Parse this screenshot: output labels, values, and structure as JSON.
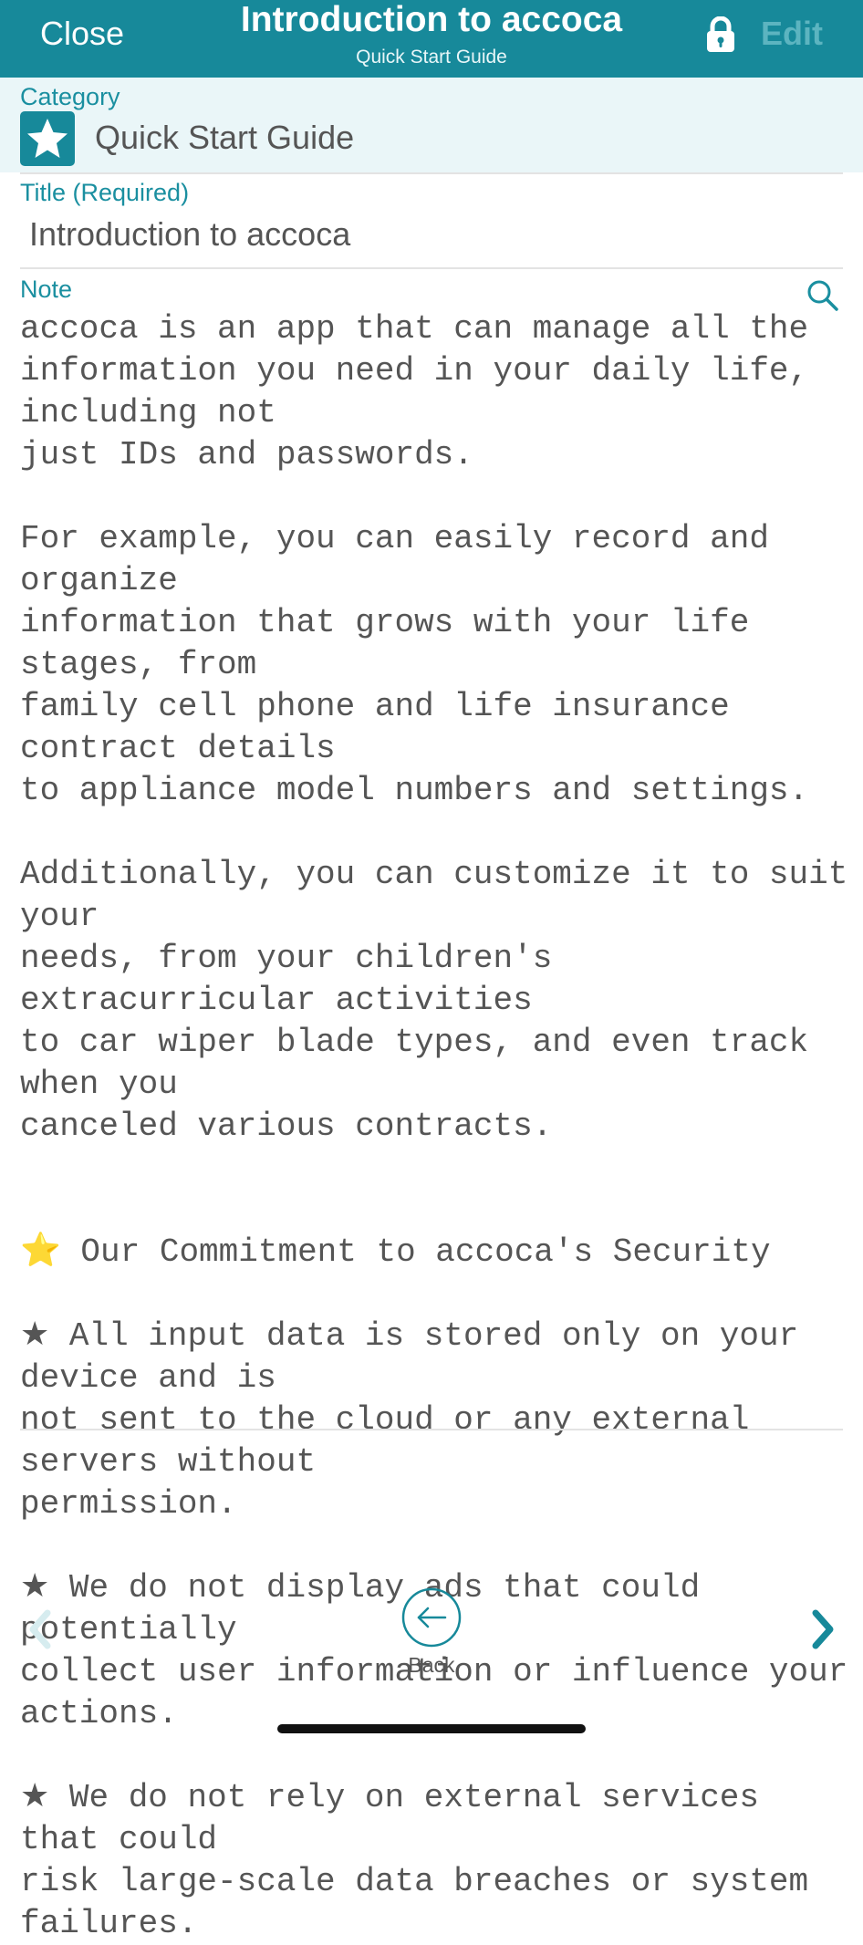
{
  "header": {
    "close_label": "Close",
    "title": "Introduction to accoca",
    "subtitle": "Quick Start Guide",
    "lock_icon": "lock-icon",
    "edit_label": "Edit"
  },
  "category": {
    "label": "Category",
    "icon": "star-icon",
    "value": "Quick Start Guide"
  },
  "title_field": {
    "label": "Title (Required)",
    "value": "Introduction to accoca"
  },
  "note": {
    "label": "Note",
    "search_icon": "search-icon",
    "text": "accoca is an app that can manage all the\ninformation you need in your daily life, including not\njust IDs and passwords.\n\nFor example, you can easily record and organize\ninformation that grows with your life stages, from\nfamily cell phone and life insurance contract details\nto appliance model numbers and settings.\n\nAdditionally, you can customize it to suit your\nneeds, from your children's extracurricular activities\nto car wiper blade types, and even track when you\ncanceled various contracts.\n\n\n⭐ Our Commitment to accoca's Security\n\n★ All input data is stored only on your device and is\nnot sent to the cloud or any external servers without\npermission.\n\n★ We do not display ads that could potentially\ncollect user information or influence your actions.\n\n★ We do not rely on external services that could\nrisk large-scale data breaches or system failures."
  },
  "bottom_nav": {
    "back_label": "Back",
    "prev_icon": "chevron-left-icon",
    "next_icon": "chevron-right-icon",
    "back_icon": "arrow-left-circle-icon"
  },
  "colors": {
    "accent": "#17899a",
    "label": "#1a8fa0",
    "category_bg": "#eaf6f8",
    "edit_disabled": "#5cb4c0"
  }
}
